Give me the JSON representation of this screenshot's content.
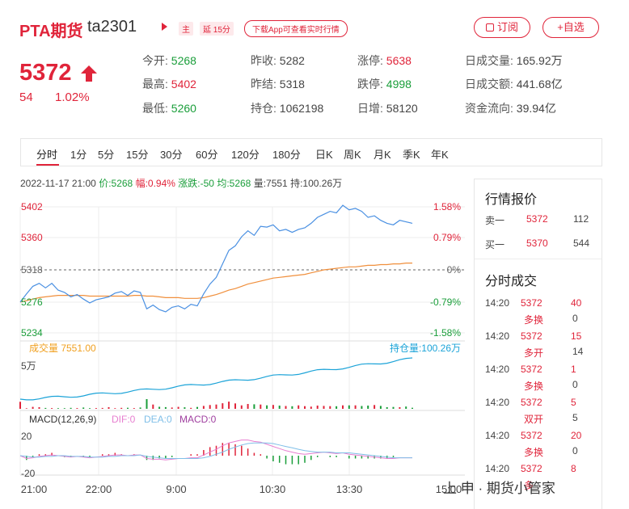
{
  "header": {
    "title": "PTA期货",
    "code": "ta2301",
    "tag_main": "主",
    "tag_delay": "延 15分",
    "download_label": "下载App可查看实时行情",
    "order_label": "订阅",
    "watch_label": "+自选"
  },
  "quote": {
    "price": "5372",
    "change": "54",
    "change_pct": "1.02%"
  },
  "stats": {
    "today_open_label": "今开:",
    "today_open": "5268",
    "prev_close_label": "昨收:",
    "prev_close": "5282",
    "limit_up_label": "涨停:",
    "limit_up": "5638",
    "day_volume_label": "日成交量:",
    "day_volume": "165.92万",
    "high_label": "最高:",
    "high": "5402",
    "prev_settle_label": "昨结:",
    "prev_settle": "5318",
    "limit_down_label": "跌停:",
    "limit_down": "4998",
    "day_amount_label": "日成交额:",
    "day_amount": "441.68亿",
    "low_label": "最低:",
    "low": "5260",
    "open_interest_label": "持仓:",
    "open_interest": "1062198",
    "daily_increase_label": "日增:",
    "daily_increase": "58120",
    "capital_flow_label": "资金流向:",
    "capital_flow": "39.94亿"
  },
  "tabs": [
    "分时",
    "1分",
    "5分",
    "15分",
    "30分",
    "60分",
    "120分",
    "180分",
    "日K",
    "周K",
    "月K",
    "季K",
    "年K"
  ],
  "info_line": {
    "datetime": "2022-11-17 21:00",
    "price": "价:5268",
    "amplitude": "幅:0.94%",
    "change": "涨跌:-50",
    "avg": "均:5268",
    "volume": "量:7551",
    "holding": "持:100.26万"
  },
  "chart_data": {
    "type": "line",
    "price_axis": {
      "ticks": [
        "5402",
        "5360",
        "5318",
        "5276",
        "5234"
      ],
      "ylim": [
        5234,
        5402
      ]
    },
    "pct_axis": {
      "ticks": [
        "1.58%",
        "0.79%",
        "0%",
        "-0.79%",
        "-1.58%"
      ]
    },
    "x_ticks": [
      "21:00",
      "22:00",
      "9:00",
      "10:30",
      "13:30",
      "15:00"
    ],
    "series": [
      {
        "name": "价",
        "color": "#4a90e2",
        "values": [
          5275,
          5286,
          5296,
          5300,
          5294,
          5300,
          5291,
          5288,
          5282,
          5285,
          5279,
          5274,
          5278,
          5280,
          5282,
          5287,
          5289,
          5284,
          5290,
          5288,
          5266,
          5271,
          5265,
          5262,
          5268,
          5270,
          5266,
          5272,
          5270,
          5286,
          5299,
          5308,
          5326,
          5344,
          5350,
          5362,
          5370,
          5364,
          5376,
          5375,
          5378,
          5370,
          5372,
          5368,
          5372,
          5374,
          5380,
          5388,
          5392,
          5396,
          5394,
          5404,
          5398,
          5400,
          5396,
          5388,
          5390,
          5384,
          5380,
          5378,
          5384,
          5382,
          5380
        ]
      },
      {
        "name": "均",
        "color": "#f08f3c",
        "values": [
          5275,
          5277,
          5279,
          5281,
          5282,
          5283,
          5284,
          5284,
          5284,
          5284,
          5284,
          5283,
          5283,
          5283,
          5283,
          5283,
          5283,
          5283,
          5284,
          5284,
          5283,
          5283,
          5282,
          5281,
          5281,
          5281,
          5280,
          5280,
          5280,
          5281,
          5283,
          5285,
          5288,
          5291,
          5293,
          5296,
          5299,
          5301,
          5303,
          5305,
          5307,
          5308,
          5309,
          5310,
          5311,
          5312,
          5314,
          5316,
          5318,
          5319,
          5320,
          5321,
          5322,
          5322,
          5323,
          5324,
          5324,
          5325,
          5325,
          5326,
          5326,
          5327,
          5327
        ]
      }
    ],
    "volume_label": "成交量",
    "volume_value": "7551.00",
    "holding_label": "持仓量",
    "holding_value": "100.26万",
    "volume_axis": {
      "ticks": [
        "5万"
      ],
      "ylim": [
        0,
        60000
      ]
    },
    "volume": [
      6500,
      500,
      1800,
      1500,
      800,
      700,
      600,
      600,
      900,
      700,
      1200,
      600,
      700,
      800,
      1500,
      600,
      900,
      1000,
      700,
      1200,
      9000,
      4000,
      1900,
      1600,
      1200,
      1800,
      1400,
      900,
      1700,
      2700,
      3500,
      4000,
      5200,
      6700,
      5000,
      3200,
      4500,
      4200,
      4000,
      3200,
      3600,
      3000,
      2600,
      2400,
      3200,
      2500,
      2000,
      3000,
      2700,
      2500,
      2400,
      3200,
      3200,
      3200,
      2600,
      3000,
      3500,
      2700,
      1500,
      1700,
      1500,
      2100,
      1000
    ],
    "macd": {
      "title": "MACD(12,26,9)",
      "dif_label": "DIF:0",
      "dea_label": "DEA:0",
      "macd_label": "MACD:0",
      "axis_ticks": [
        "20",
        "-20"
      ],
      "ylim": [
        -25,
        25
      ],
      "dif": [
        0,
        -4,
        -3,
        -1,
        0,
        1,
        0,
        -1,
        -2,
        -1,
        -2,
        -3,
        -2,
        -1,
        0,
        1,
        1,
        0,
        1,
        1,
        -4,
        -5,
        -5,
        -6,
        -5,
        -4,
        -4,
        -3,
        -3,
        1,
        5,
        9,
        14,
        18,
        20,
        22,
        22,
        20,
        19,
        16,
        13,
        10,
        7,
        5,
        3,
        2,
        3,
        4,
        5,
        4,
        3,
        4,
        2,
        1,
        0,
        -1,
        -2,
        -3,
        -4,
        -4,
        -3,
        -3,
        -3
      ],
      "dea": [
        0,
        -1,
        -2,
        -2,
        -1,
        -1,
        0,
        0,
        -1,
        -1,
        -1,
        -2,
        -2,
        -2,
        -1,
        -1,
        0,
        0,
        0,
        1,
        -1,
        -2,
        -3,
        -4,
        -4,
        -4,
        -4,
        -4,
        -4,
        -3,
        -1,
        2,
        5,
        9,
        12,
        15,
        17,
        18,
        18,
        18,
        17,
        15,
        13,
        11,
        9,
        7,
        6,
        5,
        5,
        5,
        4,
        4,
        4,
        3,
        2,
        1,
        0,
        -1,
        -2,
        -3,
        -3,
        -3,
        -3
      ],
      "bars": [
        0,
        -6,
        -2,
        2,
        2,
        4,
        0,
        -2,
        -2,
        0,
        -2,
        -2,
        0,
        2,
        2,
        4,
        2,
        0,
        2,
        0,
        -6,
        -6,
        -4,
        -4,
        -2,
        0,
        0,
        2,
        2,
        8,
        12,
        14,
        18,
        18,
        16,
        14,
        10,
        4,
        2,
        -4,
        -8,
        -10,
        -12,
        -12,
        -12,
        -10,
        -6,
        -2,
        0,
        -2,
        -2,
        0,
        -4,
        -4,
        -4,
        -4,
        -4,
        -4,
        -4,
        -2,
        0,
        0,
        0
      ]
    }
  },
  "panel": {
    "title": "行情报价",
    "sell_label": "卖一",
    "sell_price": "5372",
    "sell_qty": "112",
    "buy_label": "买一",
    "buy_price": "5370",
    "buy_qty": "544",
    "trades_title": "分时成交",
    "trades": [
      {
        "time": "14:20",
        "price": "5372",
        "qty": "40",
        "type": "多换",
        "oi": "0"
      },
      {
        "time": "14:20",
        "price": "5372",
        "qty": "15",
        "type": "多开",
        "oi": "14"
      },
      {
        "time": "14:20",
        "price": "5372",
        "qty": "1",
        "type": "多换",
        "oi": "0"
      },
      {
        "time": "14:20",
        "price": "5372",
        "qty": "5",
        "type": "双开",
        "oi": "5"
      },
      {
        "time": "14:20",
        "price": "5372",
        "qty": "20",
        "type": "多换",
        "oi": "0"
      },
      {
        "time": "14:20",
        "price": "5372",
        "qty": "8",
        "type": "多",
        "oi": ""
      }
    ]
  },
  "watermark": "上 申 · 期货小管家"
}
